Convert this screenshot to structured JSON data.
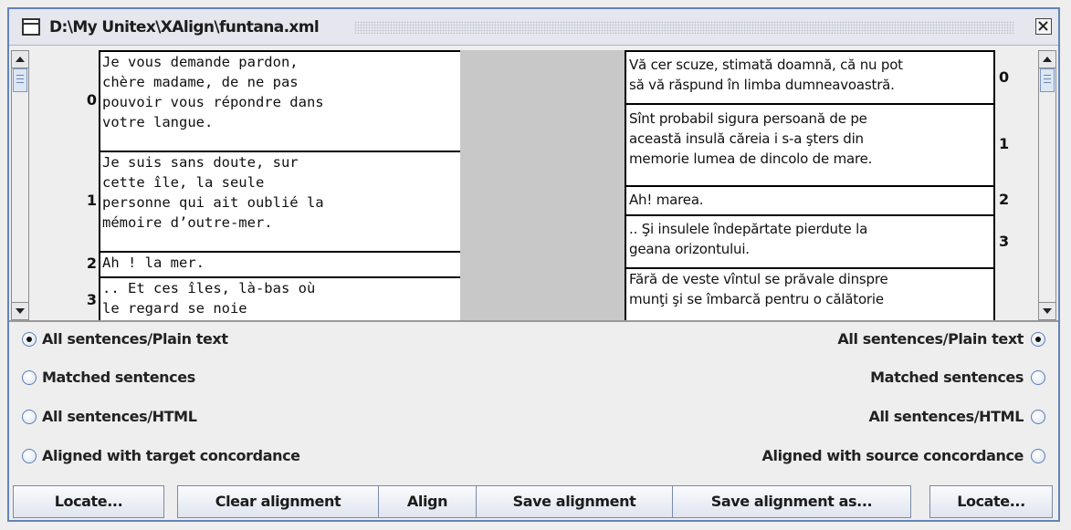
{
  "window": {
    "title": "D:\\My Unitex\\XAlign\\funtana.xml"
  },
  "source": {
    "rows": [
      {
        "num": "0",
        "text": "Je vous demande pardon,\nchère madame, de ne pas\npouvoir vous répondre dans\nvotre langue."
      },
      {
        "num": "1",
        "text": "Je suis sans doute, sur\ncette île, la seule\npersonne qui ait oublié la\nmémoire d’outre-mer."
      },
      {
        "num": "2",
        "text": "Ah ! la mer."
      },
      {
        "num": "3",
        "text": ".. Et ces îles, là-bas où\nle regard se noie"
      }
    ]
  },
  "target": {
    "rows": [
      {
        "num": "0",
        "text": "Vă cer scuze, stimată doamnă, că nu pot\nsă vă răspund în limba dumneavoastră."
      },
      {
        "num": "1",
        "text": "Sînt probabil sigura persoană de pe\naceastă insulă căreia i s-a şters din\nmemorie lumea de dincolo de mare."
      },
      {
        "num": "2",
        "text": "Ah! marea."
      },
      {
        "num": "3",
        "text": ".. Şi insulele îndepărtate pierdute la\ngeana orizontului."
      },
      {
        "num": "",
        "text": "Fără de veste vîntul se prăvale dinspre\nmunţi şi se îmbarcă pentru o călătorie"
      }
    ]
  },
  "left_options": [
    {
      "label": "All sentences/Plain text",
      "selected": true
    },
    {
      "label": "Matched sentences",
      "selected": false
    },
    {
      "label": "All sentences/HTML",
      "selected": false
    },
    {
      "label": "Aligned with target concordance",
      "selected": false
    }
  ],
  "right_options": [
    {
      "label": "All sentences/Plain text",
      "selected": true
    },
    {
      "label": "Matched sentences",
      "selected": false
    },
    {
      "label": "All sentences/HTML",
      "selected": false
    },
    {
      "label": "Aligned with source concordance",
      "selected": false
    }
  ],
  "buttons": {
    "locate_left": "Locate...",
    "clear": "Clear alignment",
    "align": "Align",
    "save": "Save alignment",
    "save_as": "Save alignment as...",
    "locate_right": "Locate..."
  },
  "colors": {
    "frame": "#6384b8",
    "gap": "#c8c8c8",
    "radio_border": "#5a7eb6"
  }
}
